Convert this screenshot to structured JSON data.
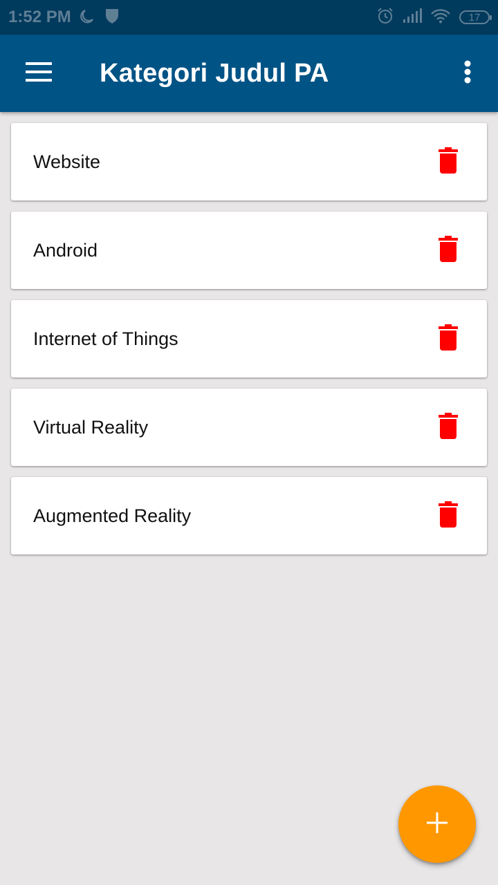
{
  "status_bar": {
    "time": "1:52 PM",
    "battery": "17",
    "icons": [
      "moon-icon",
      "shield-icon",
      "alarm-icon",
      "signal-icon",
      "wifi-icon",
      "battery-icon"
    ]
  },
  "app_bar": {
    "title": "Kategori Judul PA",
    "background": "#005385",
    "icons": [
      "hamburger-menu-icon",
      "overflow-menu-icon"
    ]
  },
  "categories": {
    "items": [
      {
        "label": "Website"
      },
      {
        "label": "Android"
      },
      {
        "label": "Internet of Things"
      },
      {
        "label": "Virtual Reality"
      },
      {
        "label": "Augmented Reality"
      }
    ],
    "delete_icon": "trash-icon",
    "delete_color": "#ff0000"
  },
  "fab": {
    "icon": "plus-icon",
    "color": "#ff9800"
  }
}
